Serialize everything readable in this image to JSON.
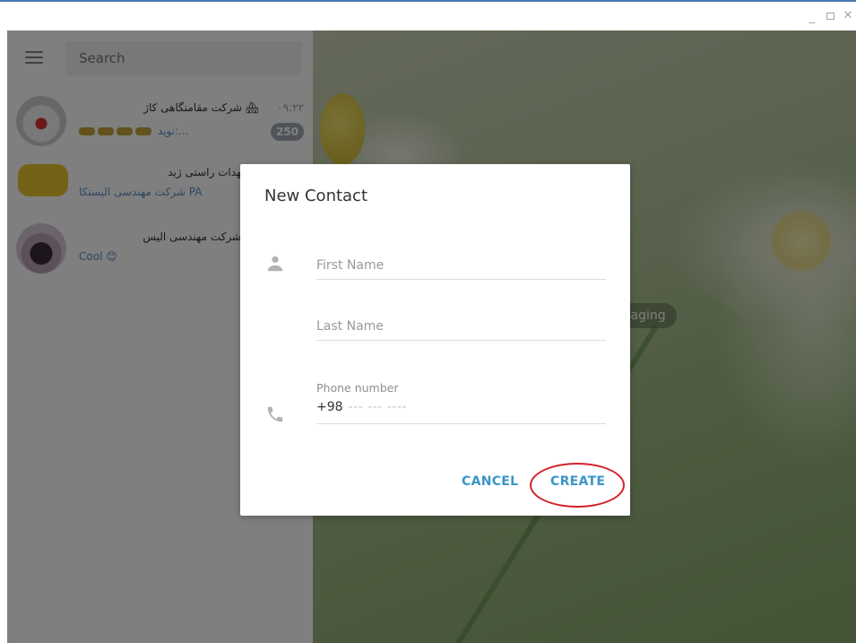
{
  "window": {
    "controls": {
      "minimize": "_",
      "close": "✕"
    }
  },
  "sidebar": {
    "search_placeholder": "Search",
    "chats": [
      {
        "title": "شرکت مقامنگاهی کاژ 🏘",
        "subtitle_prefix": "…",
        "subtitle": "نوید:...",
        "time": "۰۹:۲۲",
        "badge": "250"
      },
      {
        "title": "مدالی عهدات راستی ژید 📢",
        "subtitle": "شرکت مهندسی الیستکا PA"
      },
      {
        "title": "شرکت مهندسی الیس",
        "subtitle": "Cool 😊"
      }
    ]
  },
  "chat_area": {
    "service_message": "rt messaging"
  },
  "dialog": {
    "title": "New Contact",
    "first_name_placeholder": "First Name",
    "last_name_placeholder": "Last Name",
    "phone_label": "Phone number",
    "phone_code": "+98",
    "phone_mask": "--- --- ----",
    "cancel_label": "CANCEL",
    "create_label": "CREATE"
  },
  "colors": {
    "accent": "#3a95c8",
    "annotation": "#d3222a"
  },
  "icons": {
    "menu": "hamburger-icon",
    "person": "person-icon",
    "phone": "phone-icon"
  }
}
